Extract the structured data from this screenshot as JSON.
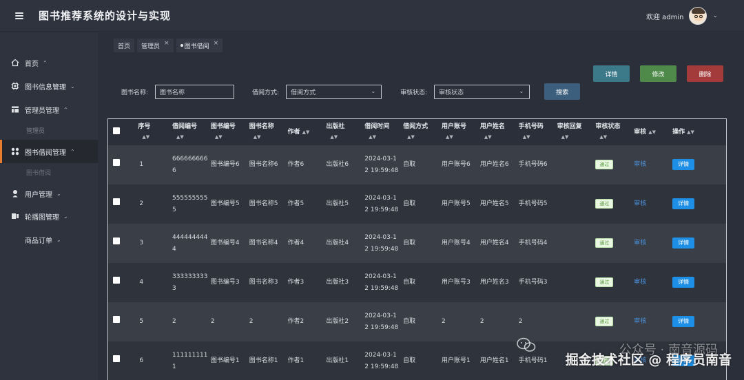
{
  "header": {
    "app_title": "图书推荐系统的设计与实现",
    "welcome": "欢迎 admin",
    "menu_toggle_icon": "hamburger-menu-icon",
    "avatar_icon": "user-avatar-icon"
  },
  "sidebar": {
    "items": [
      {
        "label": "首页",
        "icon": "home-icon"
      },
      {
        "label": "图书信息管理",
        "icon": "cpu-icon"
      },
      {
        "label": "管理员管理",
        "icon": "table-icon"
      },
      {
        "label": "管理员",
        "sub": true
      },
      {
        "label": "图书借阅管理",
        "icon": "grid-icon",
        "active": true
      },
      {
        "label": "图书借阅",
        "sub": true
      },
      {
        "label": "用户管理",
        "icon": "user-icon"
      },
      {
        "label": "轮播图管理",
        "icon": "carousel-icon"
      },
      {
        "label": "商品订单"
      }
    ]
  },
  "breadcrumb": {
    "tabs": [
      {
        "label": "首页"
      },
      {
        "label": "管理员"
      },
      {
        "label": "图书借阅",
        "active": true
      }
    ]
  },
  "toolbar": {
    "detail_label": "详情",
    "edit_label": "修改",
    "delete_label": "删除"
  },
  "search": {
    "book_name_label": "图书名称:",
    "book_name_placeholder": "图书名称",
    "borrow_method_label": "借阅方式:",
    "borrow_method_value": "借阅方式",
    "audit_status_label": "审核状态:",
    "audit_status_value": "审核状态",
    "search_button": "搜索"
  },
  "table": {
    "headers": [
      "序号",
      "借阅编号",
      "图书编号",
      "图书名称",
      "作者",
      "出版社",
      "借阅时间",
      "借阅方式",
      "用户账号",
      "用户姓名",
      "手机号码",
      "审核回复",
      "审核状态",
      "审核",
      "操作"
    ],
    "rows": [
      {
        "index": "1",
        "borrow_no": "6666666666",
        "book_no": "图书编号6",
        "book_name": "图书名称6",
        "author": "作者6",
        "publisher": "出版社6",
        "time": "2024-03-12 19:59:48",
        "method": "自取",
        "account": "用户账号6",
        "user_name": "用户姓名6",
        "phone": "手机号码6",
        "reply": "",
        "status": "通过",
        "audit": "审核",
        "action": "详情"
      },
      {
        "index": "2",
        "borrow_no": "5555555555",
        "book_no": "图书编号5",
        "book_name": "图书名称5",
        "author": "作者5",
        "publisher": "出版社5",
        "time": "2024-03-12 19:59:48",
        "method": "自取",
        "account": "用户账号5",
        "user_name": "用户姓名5",
        "phone": "手机号码5",
        "reply": "",
        "status": "通过",
        "audit": "审核",
        "action": "详情"
      },
      {
        "index": "3",
        "borrow_no": "4444444444",
        "book_no": "图书编号4",
        "book_name": "图书名称4",
        "author": "作者4",
        "publisher": "出版社4",
        "time": "2024-03-12 19:59:48",
        "method": "自取",
        "account": "用户账号4",
        "user_name": "用户姓名4",
        "phone": "手机号码4",
        "reply": "",
        "status": "通过",
        "audit": "审核",
        "action": "详情"
      },
      {
        "index": "4",
        "borrow_no": "3333333333",
        "book_no": "图书编号3",
        "book_name": "图书名称3",
        "author": "作者3",
        "publisher": "出版社3",
        "time": "2024-03-12 19:59:48",
        "method": "自取",
        "account": "用户账号3",
        "user_name": "用户姓名3",
        "phone": "手机号码3",
        "reply": "",
        "status": "通过",
        "audit": "审核",
        "action": "详情"
      },
      {
        "index": "5",
        "borrow_no": "2",
        "book_no": "2",
        "book_name": "2",
        "author": "作者2",
        "publisher": "出版社2",
        "time": "2024-03-12 19:59:48",
        "method": "自取",
        "account": "2",
        "user_name": "2",
        "phone": "2",
        "reply": "",
        "status": "通过",
        "audit": "审核",
        "action": "详情"
      },
      {
        "index": "6",
        "borrow_no": "1111111111",
        "book_no": "图书编号1",
        "book_name": "图书名称1",
        "author": "作者1",
        "publisher": "出版社1",
        "time": "2024-03-12 19:59:48",
        "method": "自取",
        "account": "用户账号1",
        "user_name": "用户姓名1",
        "phone": "手机号码1",
        "reply": "",
        "status": "通过",
        "audit": "审核",
        "action": "详情"
      }
    ]
  },
  "watermark": {
    "line1": "公众号 · 南音源码",
    "line2": "掘金技术社区 @ 程序员南音"
  }
}
